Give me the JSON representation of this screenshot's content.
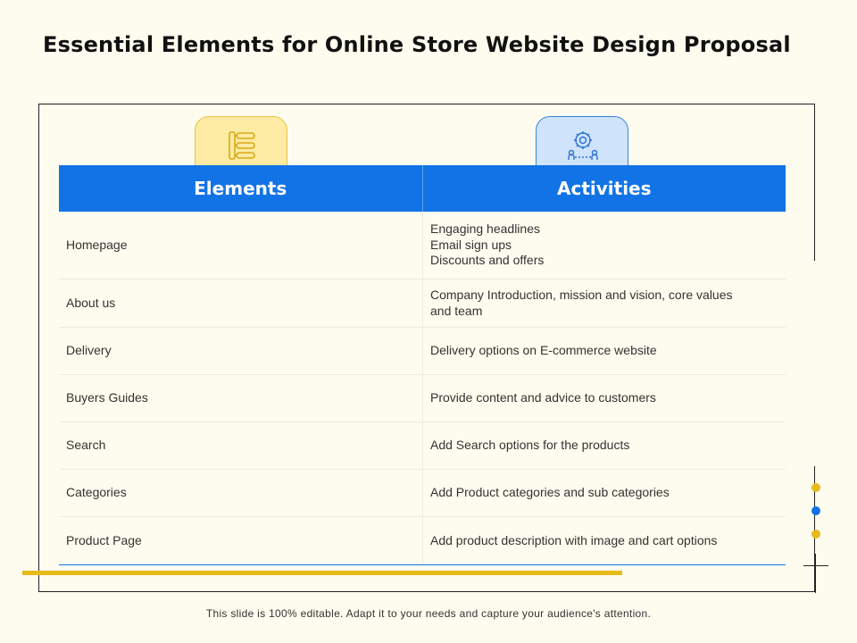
{
  "title": "Essential Elements for Online Store Website Design Proposal",
  "table": {
    "headers": [
      "Elements",
      "Activities"
    ],
    "rows": [
      {
        "element": "Homepage",
        "activity": [
          "Engaging headlines",
          "Email sign ups",
          "Discounts and offers"
        ]
      },
      {
        "element": "About us",
        "activity": [
          "Company Introduction, mission and vision, core values",
          "and team"
        ]
      },
      {
        "element": "Delivery",
        "activity": [
          "Delivery options on E-commerce website"
        ]
      },
      {
        "element": "Buyers Guides",
        "activity": [
          "Provide content and advice to customers"
        ]
      },
      {
        "element": "Search",
        "activity": [
          "Add Search options for the products"
        ]
      },
      {
        "element": "Categories",
        "activity": [
          "Add Product categories and sub categories"
        ]
      },
      {
        "element": "Product Page",
        "activity": [
          "Add product description with image and cart options"
        ]
      }
    ]
  },
  "icons": {
    "elements_icon": "list-hierarchy-icon",
    "activities_icon": "gear-people-icon"
  },
  "colors": {
    "background": "#fdfcee",
    "header_blue": "#1273e6",
    "accent_yellow": "#e8bb1c"
  },
  "footer": "This slide is 100% editable. Adapt it to your needs and capture your audience's attention."
}
